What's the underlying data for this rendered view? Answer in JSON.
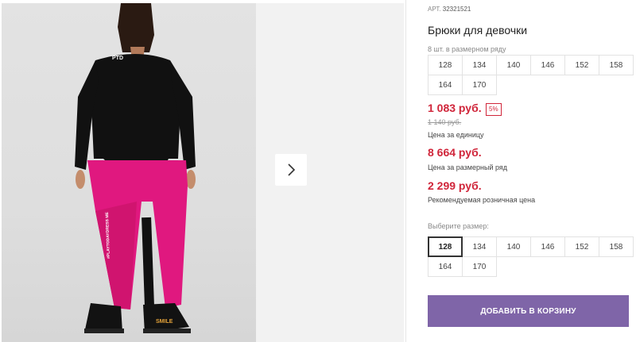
{
  "product": {
    "sku_label": "АРТ.",
    "sku_value": "32321521",
    "title": "Брюки для девочки",
    "pack_note": "8 шт. в размерном ряду",
    "pack_sizes": [
      "128",
      "134",
      "140",
      "146",
      "152",
      "158",
      "164",
      "170"
    ]
  },
  "pricing": {
    "unit_price": "1 083 руб.",
    "discount": "5%",
    "old_price": "1 140 руб.",
    "unit_caption": "Цена за единицу",
    "row_price": "8 664 руб.",
    "row_caption": "Цена за размерный ряд",
    "retail_price": "2 299 руб.",
    "retail_caption": "Рекомендуемая розничная цена"
  },
  "size_select": {
    "label": "Выберите размер:",
    "options": [
      "128",
      "134",
      "140",
      "146",
      "152",
      "158",
      "164",
      "170"
    ],
    "selected": "128"
  },
  "actions": {
    "add_to_cart": "ДОБАВИТЬ В КОРЗИНУ"
  },
  "photo_print": {
    "shirt_logo": "PTD",
    "pants_stripe": "#PLAYTODAYDRESS ME",
    "shoe_text": "SMILE"
  },
  "colors": {
    "price": "#d0253a",
    "button": "#7f65a8",
    "pants": "#e0187f"
  },
  "icons": {
    "gallery_next": "chevron-right-icon"
  }
}
